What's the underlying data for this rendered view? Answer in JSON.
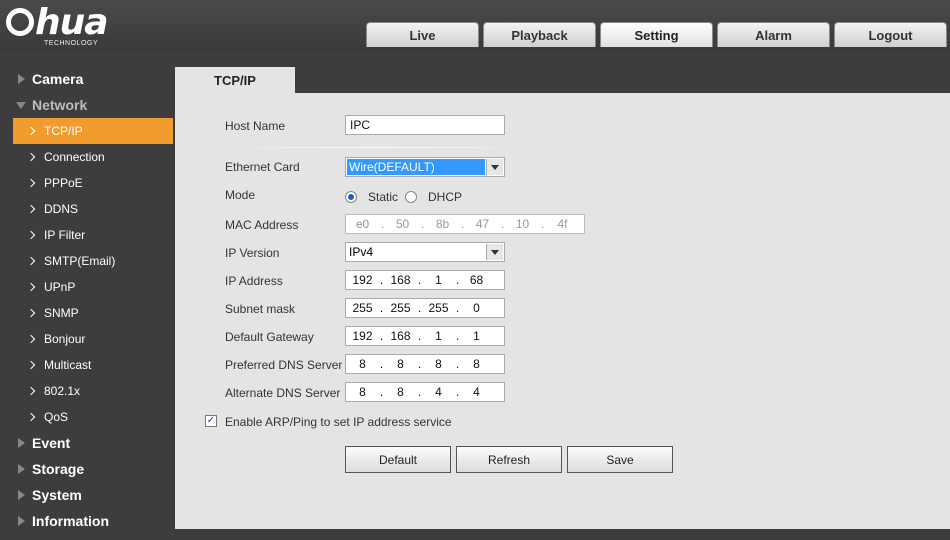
{
  "brand": {
    "logo_text": "hua",
    "logo_sub": "TECHNOLOGY"
  },
  "nav": {
    "tabs": [
      "Live",
      "Playback",
      "Setting",
      "Alarm",
      "Logout"
    ]
  },
  "sidebar": {
    "categories": {
      "camera": "Camera",
      "network": "Network",
      "event": "Event",
      "storage": "Storage",
      "system": "System",
      "information": "Information"
    },
    "network_items": [
      "TCP/IP",
      "Connection",
      "PPPoE",
      "DDNS",
      "IP Filter",
      "SMTP(Email)",
      "UPnP",
      "SNMP",
      "Bonjour",
      "Multicast",
      "802.1x",
      "QoS"
    ],
    "active_item": "TCP/IP"
  },
  "page": {
    "tab_title": "TCP/IP"
  },
  "form": {
    "host_name": {
      "label": "Host Name",
      "value": "IPC"
    },
    "ethernet_card": {
      "label": "Ethernet Card",
      "value": "Wire(DEFAULT)"
    },
    "mode": {
      "label": "Mode",
      "options": [
        "Static",
        "DHCP"
      ],
      "selected": "Static"
    },
    "mac_address": {
      "label": "MAC Address",
      "octets": [
        "e0",
        "50",
        "8b",
        "47",
        "10",
        "4f"
      ]
    },
    "ip_version": {
      "label": "IP Version",
      "value": "IPv4"
    },
    "ip_address": {
      "label": "IP Address",
      "octets": [
        "192",
        "168",
        "1",
        "68"
      ]
    },
    "subnet_mask": {
      "label": "Subnet mask",
      "octets": [
        "255",
        "255",
        "255",
        "0"
      ]
    },
    "default_gateway": {
      "label": "Default Gateway",
      "octets": [
        "192",
        "168",
        "1",
        "1"
      ]
    },
    "preferred_dns": {
      "label": "Preferred DNS Server",
      "octets": [
        "8",
        "8",
        "8",
        "8"
      ]
    },
    "alternate_dns": {
      "label": "Alternate DNS Server",
      "octets": [
        "8",
        "8",
        "4",
        "4"
      ]
    },
    "arp_ping": {
      "label": "Enable ARP/Ping to set IP address service",
      "checked": true
    }
  },
  "buttons": {
    "default": "Default",
    "refresh": "Refresh",
    "save": "Save"
  },
  "colors": {
    "accent": "#f39c2e",
    "background": "#3d3d3d",
    "panel": "#e4e4e4"
  }
}
